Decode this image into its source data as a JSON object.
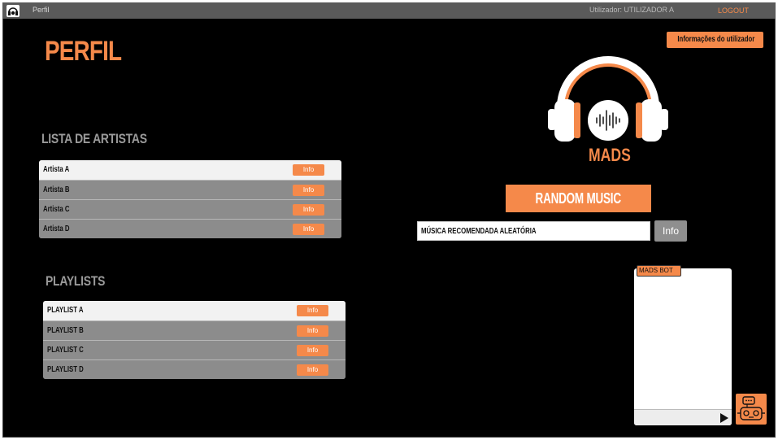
{
  "app": {
    "window_title": "Perfil",
    "user_label": "Utilizador: UTILIZADOR A",
    "logout": "LOGOUT"
  },
  "page": {
    "title": "PERFIL"
  },
  "user_info_button": "Informações do utilizador",
  "brand": {
    "name": "MADS"
  },
  "artists": {
    "title": "LISTA DE ARTISTAS",
    "items": [
      {
        "name": "Artista A",
        "button": "Info"
      },
      {
        "name": "Artista B",
        "button": "Info"
      },
      {
        "name": "Artista C",
        "button": "Info"
      },
      {
        "name": "Artista D",
        "button": "Info"
      }
    ]
  },
  "playlists": {
    "title": "PLAYLISTS",
    "items": [
      {
        "name": "PLAYLIST A",
        "button": "Info"
      },
      {
        "name": "PLAYLIST  B",
        "button": "Info"
      },
      {
        "name": "PLAYLIST  C",
        "button": "Info"
      },
      {
        "name": "PLAYLIST  D",
        "button": "Info"
      }
    ]
  },
  "random": {
    "button": "RANDOM MUSIC",
    "recommended": "MÚSICA RECOMENDADA ALEATÓRIA",
    "info_button": "Info"
  },
  "bot": {
    "label": "MADS BOT"
  },
  "icons": {
    "app_logo": "headphones-icon",
    "send": "send-icon",
    "bot": "robot-icon"
  },
  "colors": {
    "accent": "#f5894a",
    "background": "#000000",
    "topbar": "#5a5a5a",
    "row_dark": "#8c8c8c",
    "row_light": "#f2f2f2"
  }
}
